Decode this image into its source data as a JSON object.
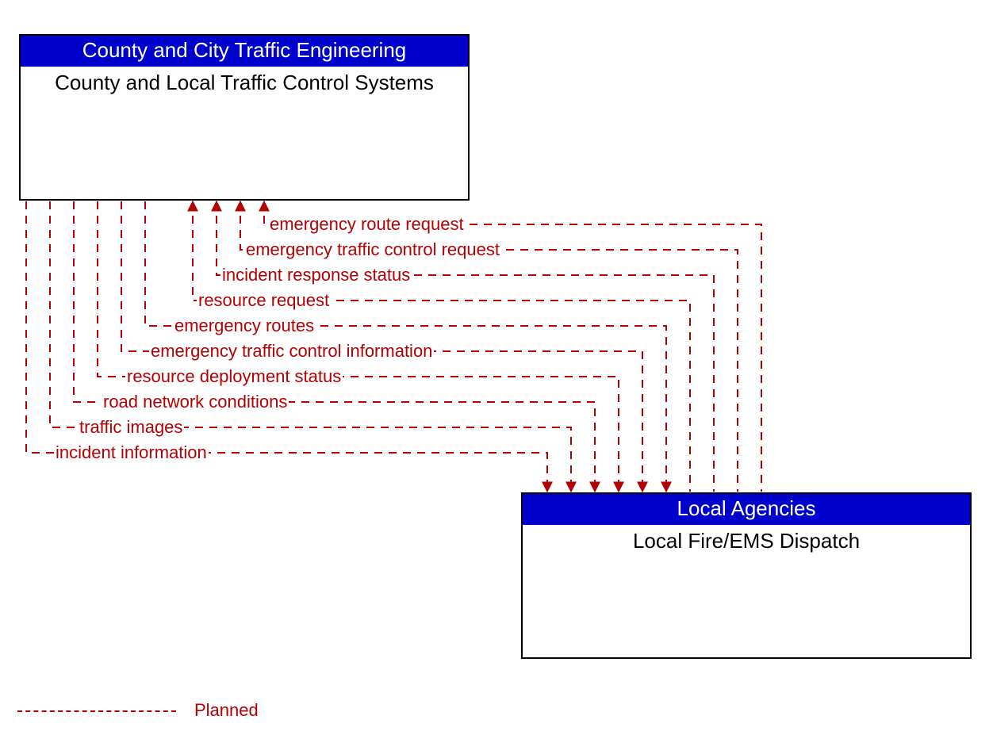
{
  "entities": {
    "top": {
      "header": "County and City Traffic Engineering",
      "body": "County and Local Traffic Control Systems"
    },
    "bottom": {
      "header": "Local Agencies",
      "body": "Local Fire/EMS Dispatch"
    }
  },
  "flows": {
    "f1": "emergency route request",
    "f2": "emergency traffic control request",
    "f3": "incident response status",
    "f4": "resource request",
    "f5": "emergency routes",
    "f6": "emergency traffic control information",
    "f7": "resource deployment status",
    "f8": "road network conditions",
    "f9": "traffic images",
    "f10": "incident information"
  },
  "legend": {
    "planned": "Planned"
  },
  "colors": {
    "flow": "#b30000",
    "header_bg": "#0000cc"
  }
}
